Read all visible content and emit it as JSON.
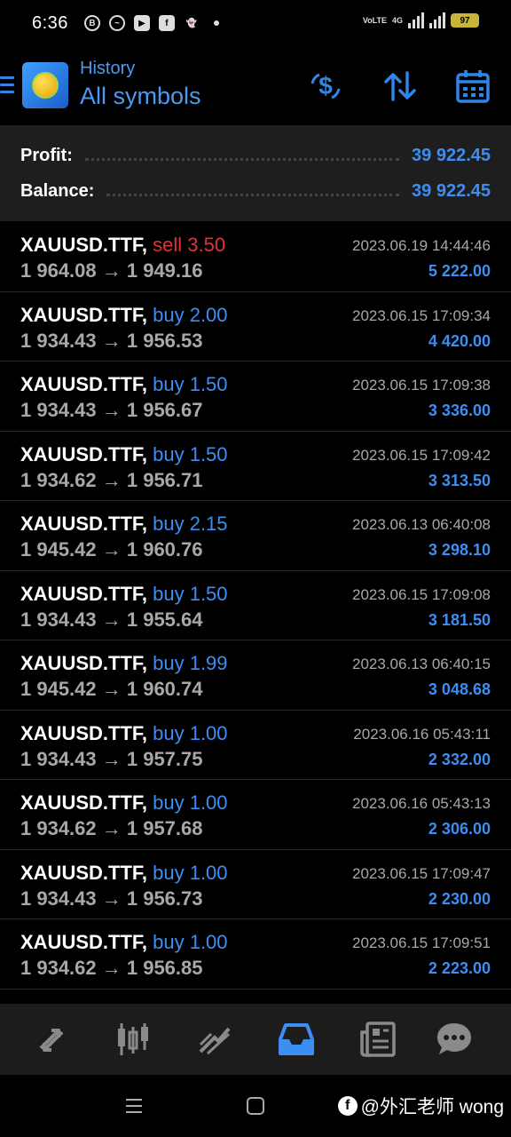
{
  "status_bar": {
    "time": "6:36",
    "network": "4G",
    "volte": "VoLTE",
    "battery": "97"
  },
  "header": {
    "subtitle": "History",
    "title": "All symbols"
  },
  "summary": {
    "profit_label": "Profit:",
    "profit_value": "39 922.45",
    "balance_label": "Balance:",
    "balance_value": "39 922.45"
  },
  "deals": [
    {
      "symbol": "XAUUSD.TTF,",
      "side": "sell 3.50",
      "type": "sell",
      "prices": "1 964.08 → 1 949.16",
      "time": "2023.06.19 14:44:46",
      "profit": "5 222.00"
    },
    {
      "symbol": "XAUUSD.TTF,",
      "side": "buy 2.00",
      "type": "buy",
      "prices": "1 934.43 → 1 956.53",
      "time": "2023.06.15 17:09:34",
      "profit": "4 420.00"
    },
    {
      "symbol": "XAUUSD.TTF,",
      "side": "buy 1.50",
      "type": "buy",
      "prices": "1 934.43 → 1 956.67",
      "time": "2023.06.15 17:09:38",
      "profit": "3 336.00"
    },
    {
      "symbol": "XAUUSD.TTF,",
      "side": "buy 1.50",
      "type": "buy",
      "prices": "1 934.62 → 1 956.71",
      "time": "2023.06.15 17:09:42",
      "profit": "3 313.50"
    },
    {
      "symbol": "XAUUSD.TTF,",
      "side": "buy 2.15",
      "type": "buy",
      "prices": "1 945.42 → 1 960.76",
      "time": "2023.06.13 06:40:08",
      "profit": "3 298.10"
    },
    {
      "symbol": "XAUUSD.TTF,",
      "side": "buy 1.50",
      "type": "buy",
      "prices": "1 934.43 → 1 955.64",
      "time": "2023.06.15 17:09:08",
      "profit": "3 181.50"
    },
    {
      "symbol": "XAUUSD.TTF,",
      "side": "buy 1.99",
      "type": "buy",
      "prices": "1 945.42 → 1 960.74",
      "time": "2023.06.13 06:40:15",
      "profit": "3 048.68"
    },
    {
      "symbol": "XAUUSD.TTF,",
      "side": "buy 1.00",
      "type": "buy",
      "prices": "1 934.43 → 1 957.75",
      "time": "2023.06.16 05:43:11",
      "profit": "2 332.00"
    },
    {
      "symbol": "XAUUSD.TTF,",
      "side": "buy 1.00",
      "type": "buy",
      "prices": "1 934.62 → 1 957.68",
      "time": "2023.06.16 05:43:13",
      "profit": "2 306.00"
    },
    {
      "symbol": "XAUUSD.TTF,",
      "side": "buy 1.00",
      "type": "buy",
      "prices": "1 934.43 → 1 956.73",
      "time": "2023.06.15 17:09:47",
      "profit": "2 230.00"
    },
    {
      "symbol": "XAUUSD.TTF,",
      "side": "buy 1.00",
      "type": "buy",
      "prices": "1 934.62 → 1 956.85",
      "time": "2023.06.15 17:09:51",
      "profit": "2 223.00"
    }
  ],
  "bottom_nav": [
    {
      "icon": "quotes-icon"
    },
    {
      "icon": "chart-icon"
    },
    {
      "icon": "trade-icon"
    },
    {
      "icon": "history-icon",
      "active": true
    },
    {
      "icon": "news-icon"
    },
    {
      "icon": "chat-icon"
    }
  ],
  "watermark": {
    "text": "@外汇老师 wong"
  },
  "colors": {
    "accent": "#3d8ef2",
    "sell": "#e0333a",
    "muted": "#a8a8a8"
  }
}
